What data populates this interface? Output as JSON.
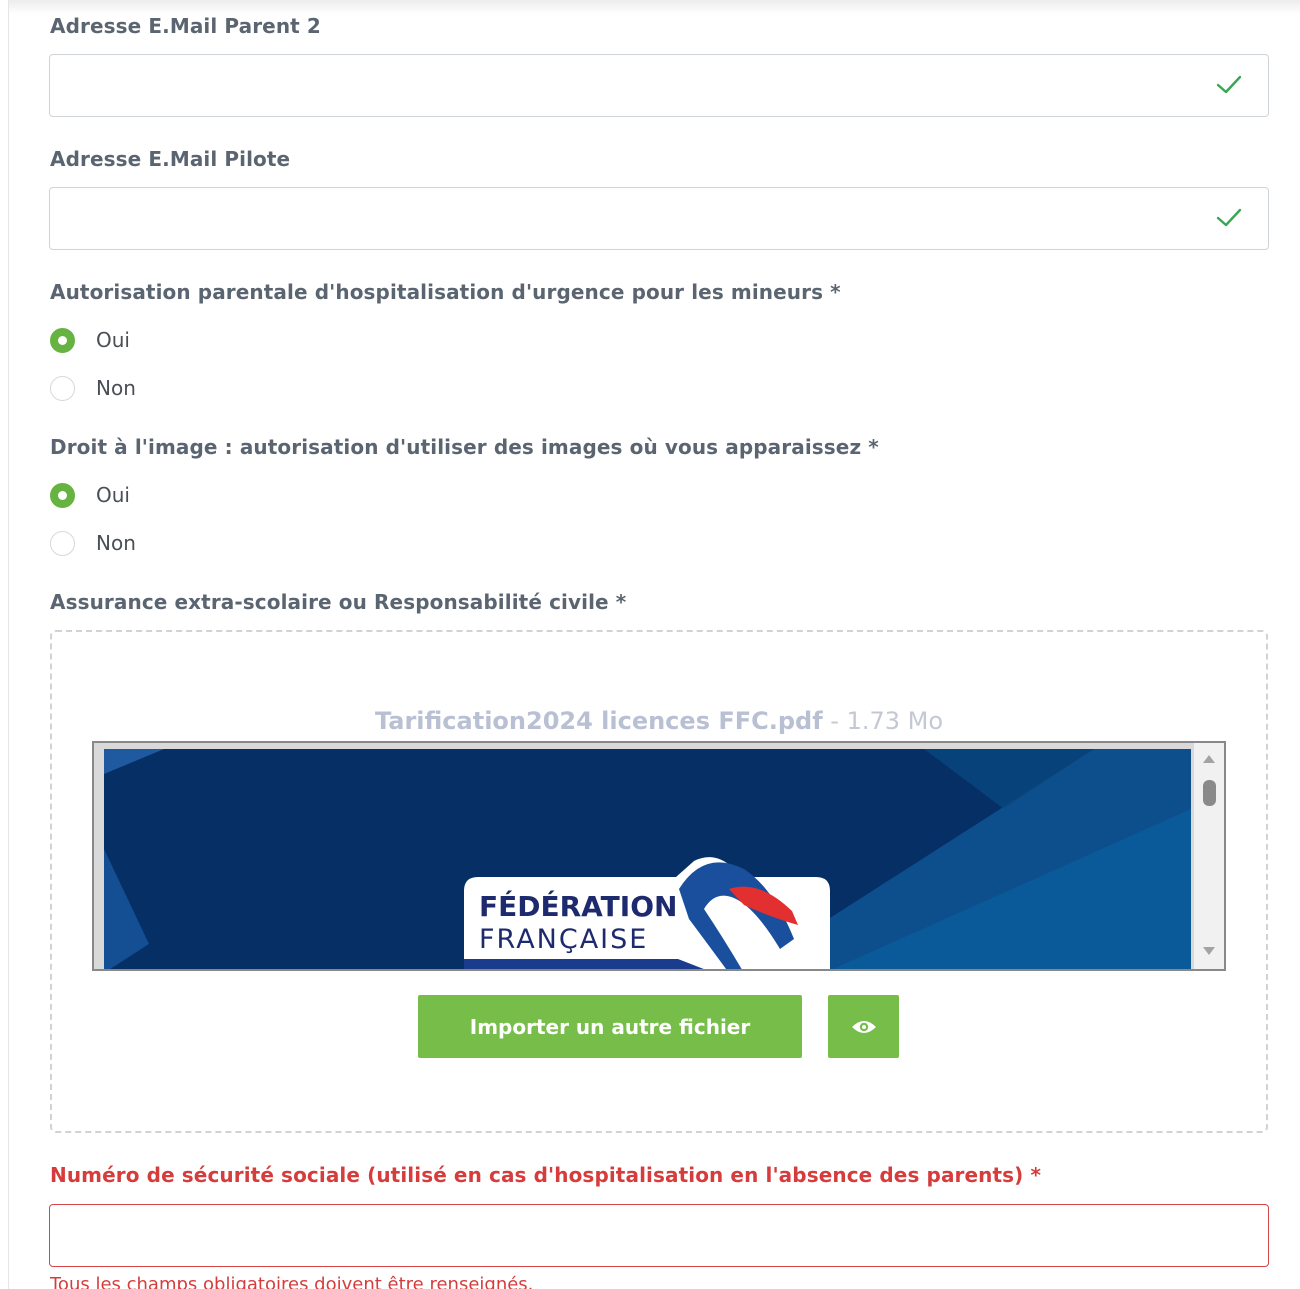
{
  "form": {
    "email_parent2": {
      "label": "Adresse E.Mail Parent 2",
      "value": ""
    },
    "email_pilote": {
      "label": "Adresse E.Mail Pilote",
      "value": ""
    },
    "hospitalisation": {
      "label": "Autorisation parentale d'hospitalisation d'urgence pour les mineurs *",
      "options": [
        {
          "label": "Oui",
          "checked": true
        },
        {
          "label": "Non",
          "checked": false
        }
      ]
    },
    "droit_image": {
      "label": "Droit à l'image : autorisation d'utiliser des images où vous apparaissez *",
      "options": [
        {
          "label": "Oui",
          "checked": true
        },
        {
          "label": "Non",
          "checked": false
        }
      ]
    },
    "assurance": {
      "label": "Assurance extra-scolaire ou Responsabilité civile *",
      "file_name": "Tarification2024 licences FFC.pdf",
      "file_size": " - 1.73 Mo",
      "preview_line1": "FÉDÉRATION",
      "preview_line2": "FRANÇAISE",
      "import_button": "Importer un autre fichier",
      "view_icon": "eye-icon"
    },
    "secu": {
      "label": "Numéro de sécurité sociale (utilisé en cas d'hospitalisation en l'absence des parents) *",
      "value": ""
    },
    "error_message": "Tous les champs obligatoires doivent être renseignés."
  },
  "colors": {
    "accent_green": "#77bd4a",
    "radio_green": "#66b341",
    "check_green": "#3aa655",
    "error_red": "#d63c3c"
  }
}
